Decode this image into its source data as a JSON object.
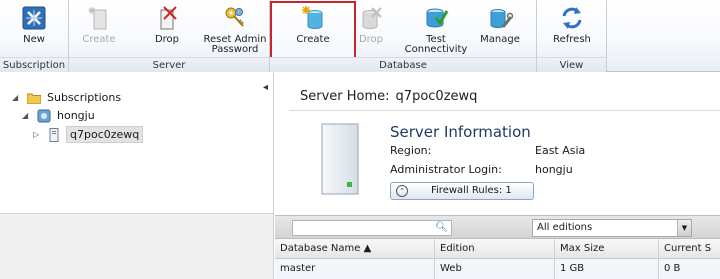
{
  "ribbon": {
    "groups": [
      {
        "label": "Subscription"
      },
      {
        "label": "Server"
      },
      {
        "label": "Database"
      },
      {
        "label": "View"
      }
    ],
    "buttons": {
      "new": "New",
      "create_server": "Create",
      "drop_server": "Drop",
      "reset_admin_password": "Reset Admin\nPassword",
      "create_database": "Create",
      "drop_database": "Drop",
      "test_connectivity": "Test\nConnectivity",
      "manage": "Manage",
      "refresh": "Refresh"
    }
  },
  "tree": {
    "root": "Subscriptions",
    "subscription": "hongju",
    "server": "q7poc0zewq"
  },
  "server_home": {
    "label": "Server Home:",
    "value": "q7poc0zewq"
  },
  "server_info": {
    "title": "Server Information",
    "region_label": "Region:",
    "region_value": "East Asia",
    "admin_label": "Administrator Login:",
    "admin_value": "hongju",
    "firewall_button": "Firewall Rules: 1"
  },
  "filter": {
    "search_value": "",
    "editions_selected": "All editions"
  },
  "table": {
    "columns": [
      "Database Name ▲",
      "Edition",
      "Max Size",
      "Current S"
    ],
    "rows": [
      [
        "master",
        "Web",
        "1 GB",
        "0 B"
      ]
    ]
  },
  "colors": {
    "selection_border": "#c8262c",
    "accent": "#1f3b60"
  }
}
